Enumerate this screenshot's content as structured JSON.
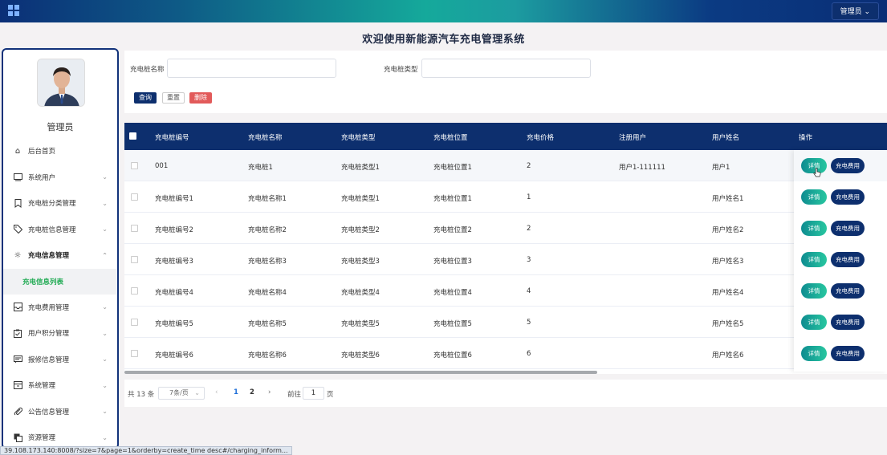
{
  "header": {
    "admin_button": "管理员 ⌄",
    "title": "欢迎使用新能源汽车充电管理系统"
  },
  "sidebar": {
    "username": "管理员",
    "items": [
      {
        "label": "后台首页",
        "icon": "home-icon"
      },
      {
        "label": "系统用户",
        "icon": "monitor-icon"
      },
      {
        "label": "充电桩分类管理",
        "icon": "bookmark-icon"
      },
      {
        "label": "充电桩信息管理",
        "icon": "tag-icon"
      },
      {
        "label": "充电信息管理",
        "icon": "sun-icon"
      },
      {
        "label": "充电信息列表",
        "icon": ""
      },
      {
        "label": "充电费用管理",
        "icon": "inbox-icon"
      },
      {
        "label": "用户积分管理",
        "icon": "clipboard-icon"
      },
      {
        "label": "报修信息管理",
        "icon": "message-icon"
      },
      {
        "label": "系统管理",
        "icon": "archive-icon"
      },
      {
        "label": "公告信息管理",
        "icon": "paperclip-icon"
      },
      {
        "label": "资源管理",
        "icon": "copy-icon"
      }
    ]
  },
  "search": {
    "name_label": "充电桩名称",
    "type_label": "充电桩类型",
    "query_button": "查询",
    "reset_button": "重置",
    "delete_button": "删除"
  },
  "table": {
    "columns": [
      "充电桩编号",
      "充电桩名称",
      "充电桩类型",
      "充电桩位置",
      "充电价格",
      "注册用户",
      "用户姓名",
      "操作"
    ],
    "rows": [
      [
        "001",
        "充电桩1",
        "充电桩类型1",
        "充电桩位置1",
        "2",
        "用户1-111111",
        "用户1"
      ],
      [
        "充电桩编号1",
        "充电桩名称1",
        "充电桩类型1",
        "充电桩位置1",
        "1",
        "",
        "用户姓名1"
      ],
      [
        "充电桩编号2",
        "充电桩名称2",
        "充电桩类型2",
        "充电桩位置2",
        "2",
        "",
        "用户姓名2"
      ],
      [
        "充电桩编号3",
        "充电桩名称3",
        "充电桩类型3",
        "充电桩位置3",
        "3",
        "",
        "用户姓名3"
      ],
      [
        "充电桩编号4",
        "充电桩名称4",
        "充电桩类型4",
        "充电桩位置4",
        "4",
        "",
        "用户姓名4"
      ],
      [
        "充电桩编号5",
        "充电桩名称5",
        "充电桩类型5",
        "充电桩位置5",
        "5",
        "",
        "用户姓名5"
      ],
      [
        "充电桩编号6",
        "充电桩名称6",
        "充电桩类型6",
        "充电桩位置6",
        "6",
        "",
        "用户姓名6"
      ]
    ],
    "detail_button": "详情",
    "fee_button": "充电费用"
  },
  "pager": {
    "total": "共 13 条",
    "page_size": "7条/页",
    "prev": "‹",
    "page1": "1",
    "page2": "2",
    "next": "›",
    "goto_label": "前往",
    "goto_value": "1",
    "page_label": "页"
  },
  "status_url": "39.108.173.140:8008/?size=7&page=1&orderby=create_time desc#/charging_inform..."
}
